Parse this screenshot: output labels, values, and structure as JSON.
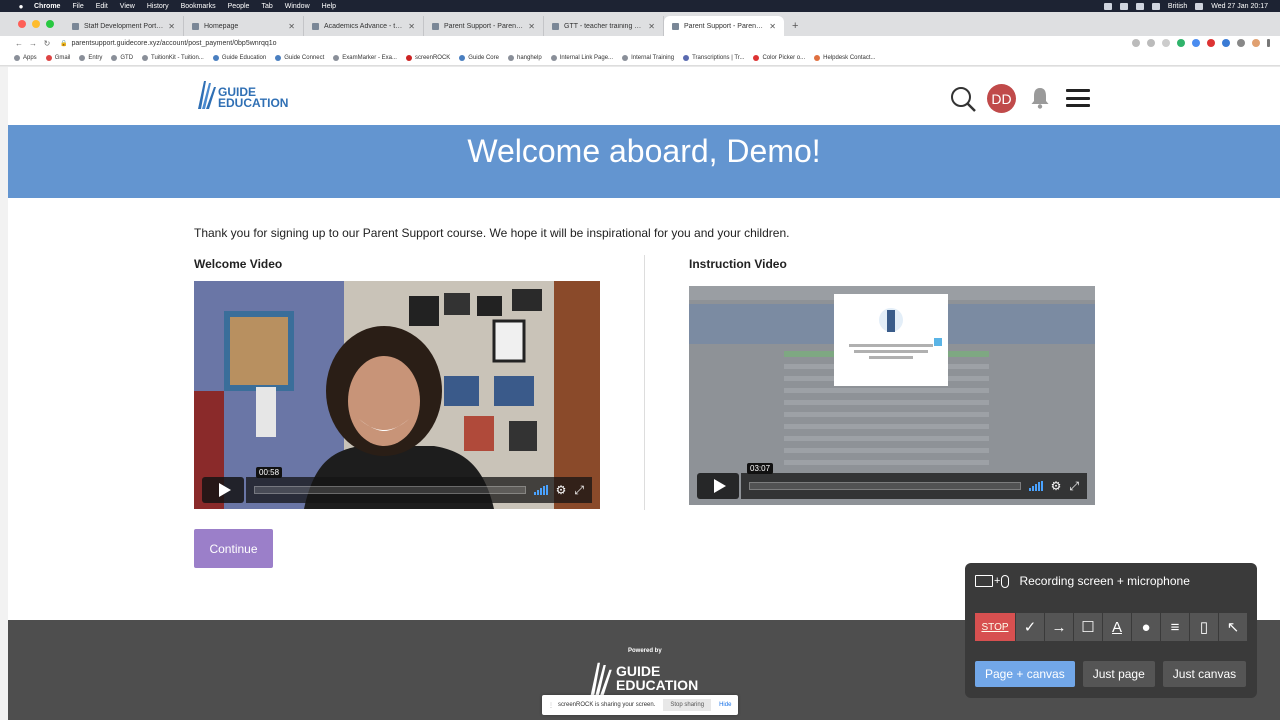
{
  "menubar": {
    "app": "Chrome",
    "menus": [
      "File",
      "Edit",
      "View",
      "History",
      "Bookmarks",
      "People",
      "Tab",
      "Window",
      "Help"
    ],
    "locale": "British",
    "datetime": "Wed 27 Jan  20:17"
  },
  "tabs": [
    {
      "label": "Staff Development Portal - Sta",
      "active": false
    },
    {
      "label": "Homepage",
      "active": false
    },
    {
      "label": "Academics Advance - training",
      "active": false
    },
    {
      "label": "Parent Support - Parent Suppo",
      "active": false
    },
    {
      "label": "GTT - teacher training videos",
      "active": false
    },
    {
      "label": "Parent Support - Parent Suppo",
      "active": true
    }
  ],
  "toolbar": {
    "url": "parentsupport.guidecore.xyz/account/post_payment/0bp5wnrqq1o"
  },
  "bookmarks": [
    "Apps",
    "Gmail",
    "Entry",
    "GTD",
    "TuitionKit - Tuition...",
    "Guide Education",
    "Guide Connect",
    "ExamMarker - Exa...",
    "screenROCK",
    "Guide Core",
    "hanghelp",
    "Internal Link Page...",
    "Internal Training",
    "Transcriptions | Tr...",
    "Color Picker o...",
    "Helpdesk Contact..."
  ],
  "header": {
    "logo_line1": "GUIDE",
    "logo_line2": "EDUCATION",
    "avatar_initials": "DD"
  },
  "banner": {
    "title": "Welcome aboard, Demo!"
  },
  "main": {
    "intro": "Thank you for signing up to our Parent Support course. We hope it will be inspirational for you and your children.",
    "welcome_video": {
      "title": "Welcome Video",
      "time": "00:58"
    },
    "instruction_video": {
      "title": "Instruction Video",
      "time": "03:07"
    },
    "continue_label": "Continue"
  },
  "footer": {
    "powered_by": "Powered by",
    "logo_line1": "GUIDE",
    "logo_line2": "EDUCATION"
  },
  "share_bar": {
    "message": "screenROCK is sharing your screen.",
    "stop_label": "Stop sharing",
    "hide_label": "Hide"
  },
  "recorder": {
    "status": "Recording screen + microphone",
    "stop_label": "STOP",
    "tools": [
      "pen-icon",
      "arrow-icon",
      "rectangle-icon",
      "text-icon",
      "palette-icon",
      "lines-icon",
      "trash-icon",
      "cursor-icon"
    ],
    "modes": [
      {
        "label": "Page + canvas",
        "active": true
      },
      {
        "label": "Just page",
        "active": false
      },
      {
        "label": "Just canvas",
        "active": false
      }
    ]
  }
}
